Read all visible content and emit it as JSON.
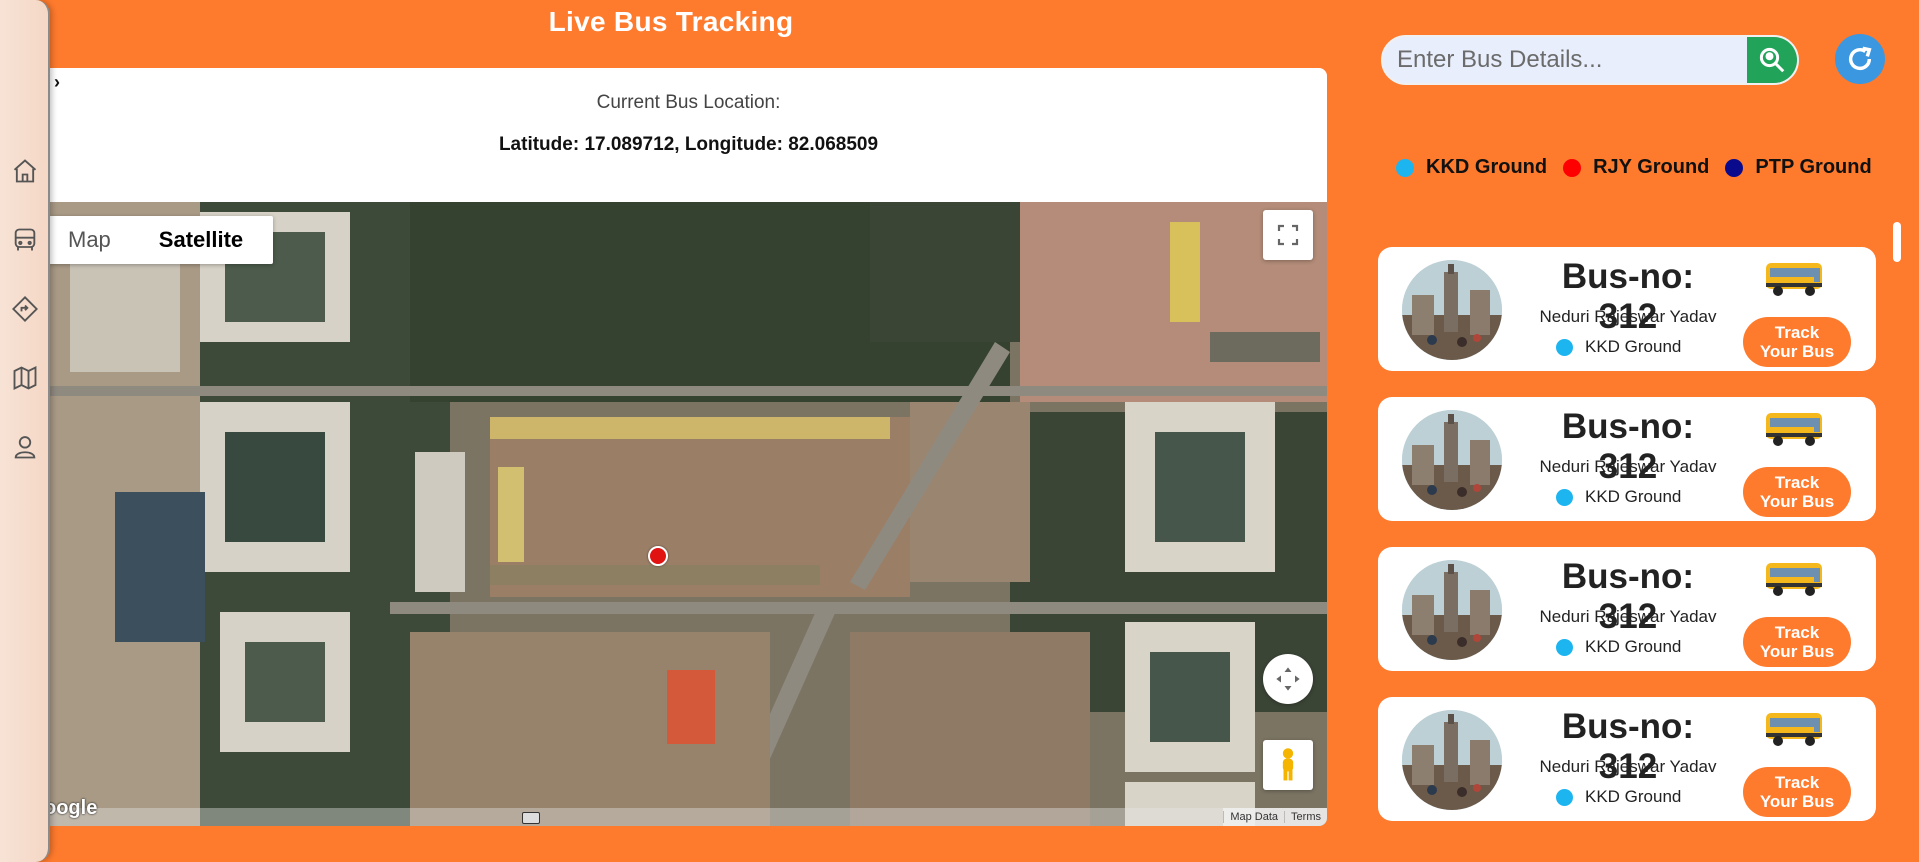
{
  "page": {
    "title": "Live Bus Tracking"
  },
  "location": {
    "label": "Current Bus Location:",
    "coords": "Latitude: 17.089712, Longitude: 82.068509"
  },
  "map": {
    "tabs": [
      "Map",
      "Satellite"
    ],
    "active_tab": "Satellite",
    "google_mark": "oogle",
    "attribution": [
      "Map Data",
      "Terms"
    ]
  },
  "search": {
    "placeholder": "Enter Bus Details..."
  },
  "legend": [
    {
      "label": "KKD Ground",
      "color": "#1CB5F0"
    },
    {
      "label": "RJY Ground",
      "color": "#FF0000"
    },
    {
      "label": "PTP Ground",
      "color": "#0A0A8C"
    }
  ],
  "buses": [
    {
      "bus_no": "Bus-no: 312",
      "driver": "Neduri Rajeswar Yadav",
      "ground": "KKD Ground",
      "action": "Track Your Bus"
    },
    {
      "bus_no": "Bus-no: 312",
      "driver": "Neduri Rajeswar Yadav",
      "ground": "KKD Ground",
      "action": "Track Your Bus"
    },
    {
      "bus_no": "Bus-no: 312",
      "driver": "Neduri Rajeswar Yadav",
      "ground": "KKD Ground",
      "action": "Track Your Bus"
    },
    {
      "bus_no": "Bus-no: 312",
      "driver": "Neduri Rajeswar Yadav",
      "ground": "KKD Ground",
      "action": "Track Your Bus"
    }
  ],
  "sidebar": {
    "icons": [
      "home-icon",
      "bus-icon",
      "directions-icon",
      "map-icon",
      "user-icon"
    ]
  },
  "colors": {
    "background": "#FE7A2D",
    "search_button": "#21A35A",
    "refresh_button": "#3B97E0",
    "marker": "#E01212"
  }
}
